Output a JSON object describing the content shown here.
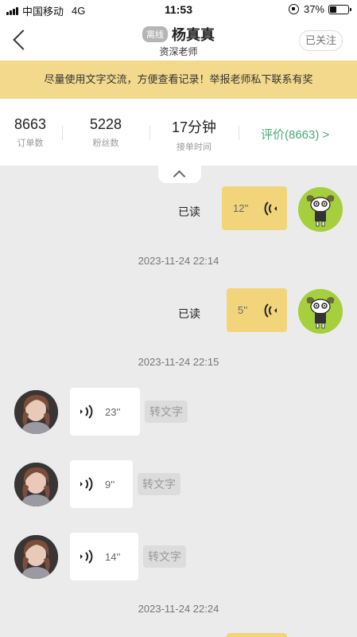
{
  "status_bar": {
    "carrier": "中国移动",
    "network": "4G",
    "time": "11:53",
    "battery": "37%",
    "battery_level": 0.37
  },
  "header": {
    "status_badge": "离线",
    "name": "杨真真",
    "role": "资深老师",
    "follow_label": "已关注"
  },
  "notice": "尽量使用文字交流，方便查看记录！举报老师私下联系有奖",
  "stats": {
    "orders": {
      "value": "8663",
      "label": "订单数"
    },
    "fans": {
      "value": "5228",
      "label": "粉丝数"
    },
    "response": {
      "value": "17分钟",
      "label": "接单时间"
    },
    "rating_link": "评价(8663) >"
  },
  "messages": [
    {
      "side": "sent",
      "read": "已读",
      "duration": "12''"
    },
    {
      "timestamp": "2023-11-24 22:14"
    },
    {
      "side": "sent",
      "read": "已读",
      "duration": "5''"
    },
    {
      "timestamp": "2023-11-24 22:15"
    },
    {
      "side": "received",
      "duration": "23''",
      "action": "转文字"
    },
    {
      "side": "received",
      "duration": "9''",
      "action": "转文字"
    },
    {
      "side": "received",
      "duration": "14''",
      "action": "转文字"
    },
    {
      "timestamp": "2023-11-24 22:24"
    }
  ],
  "colors": {
    "sent_bubble": "#f2d57a",
    "notice_bg": "#f2d98c",
    "rating_green": "#4aa97a",
    "chat_bg": "#ebebeb"
  }
}
